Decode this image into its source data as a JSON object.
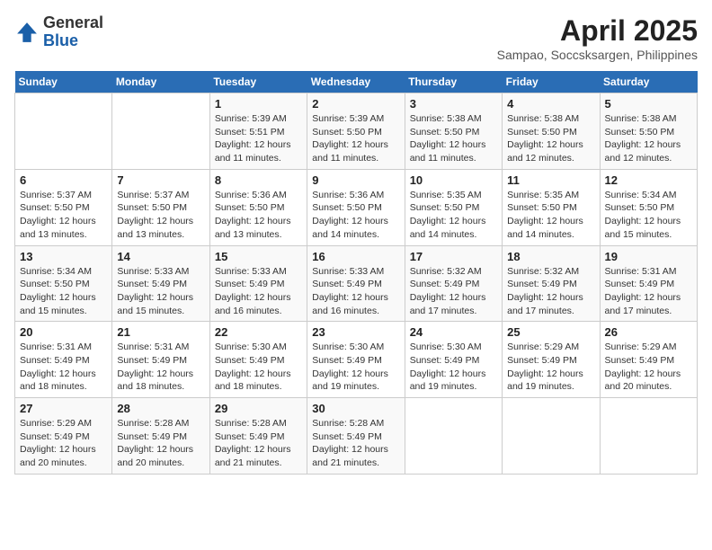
{
  "header": {
    "logo_line1": "General",
    "logo_line2": "Blue",
    "month_title": "April 2025",
    "location": "Sampao, Soccsksargen, Philippines"
  },
  "days_of_week": [
    "Sunday",
    "Monday",
    "Tuesday",
    "Wednesday",
    "Thursday",
    "Friday",
    "Saturday"
  ],
  "weeks": [
    [
      {
        "day": "",
        "sunrise": "",
        "sunset": "",
        "daylight": ""
      },
      {
        "day": "",
        "sunrise": "",
        "sunset": "",
        "daylight": ""
      },
      {
        "day": "1",
        "sunrise": "Sunrise: 5:39 AM",
        "sunset": "Sunset: 5:51 PM",
        "daylight": "Daylight: 12 hours and 11 minutes."
      },
      {
        "day": "2",
        "sunrise": "Sunrise: 5:39 AM",
        "sunset": "Sunset: 5:50 PM",
        "daylight": "Daylight: 12 hours and 11 minutes."
      },
      {
        "day": "3",
        "sunrise": "Sunrise: 5:38 AM",
        "sunset": "Sunset: 5:50 PM",
        "daylight": "Daylight: 12 hours and 11 minutes."
      },
      {
        "day": "4",
        "sunrise": "Sunrise: 5:38 AM",
        "sunset": "Sunset: 5:50 PM",
        "daylight": "Daylight: 12 hours and 12 minutes."
      },
      {
        "day": "5",
        "sunrise": "Sunrise: 5:38 AM",
        "sunset": "Sunset: 5:50 PM",
        "daylight": "Daylight: 12 hours and 12 minutes."
      }
    ],
    [
      {
        "day": "6",
        "sunrise": "Sunrise: 5:37 AM",
        "sunset": "Sunset: 5:50 PM",
        "daylight": "Daylight: 12 hours and 13 minutes."
      },
      {
        "day": "7",
        "sunrise": "Sunrise: 5:37 AM",
        "sunset": "Sunset: 5:50 PM",
        "daylight": "Daylight: 12 hours and 13 minutes."
      },
      {
        "day": "8",
        "sunrise": "Sunrise: 5:36 AM",
        "sunset": "Sunset: 5:50 PM",
        "daylight": "Daylight: 12 hours and 13 minutes."
      },
      {
        "day": "9",
        "sunrise": "Sunrise: 5:36 AM",
        "sunset": "Sunset: 5:50 PM",
        "daylight": "Daylight: 12 hours and 14 minutes."
      },
      {
        "day": "10",
        "sunrise": "Sunrise: 5:35 AM",
        "sunset": "Sunset: 5:50 PM",
        "daylight": "Daylight: 12 hours and 14 minutes."
      },
      {
        "day": "11",
        "sunrise": "Sunrise: 5:35 AM",
        "sunset": "Sunset: 5:50 PM",
        "daylight": "Daylight: 12 hours and 14 minutes."
      },
      {
        "day": "12",
        "sunrise": "Sunrise: 5:34 AM",
        "sunset": "Sunset: 5:50 PM",
        "daylight": "Daylight: 12 hours and 15 minutes."
      }
    ],
    [
      {
        "day": "13",
        "sunrise": "Sunrise: 5:34 AM",
        "sunset": "Sunset: 5:50 PM",
        "daylight": "Daylight: 12 hours and 15 minutes."
      },
      {
        "day": "14",
        "sunrise": "Sunrise: 5:33 AM",
        "sunset": "Sunset: 5:49 PM",
        "daylight": "Daylight: 12 hours and 15 minutes."
      },
      {
        "day": "15",
        "sunrise": "Sunrise: 5:33 AM",
        "sunset": "Sunset: 5:49 PM",
        "daylight": "Daylight: 12 hours and 16 minutes."
      },
      {
        "day": "16",
        "sunrise": "Sunrise: 5:33 AM",
        "sunset": "Sunset: 5:49 PM",
        "daylight": "Daylight: 12 hours and 16 minutes."
      },
      {
        "day": "17",
        "sunrise": "Sunrise: 5:32 AM",
        "sunset": "Sunset: 5:49 PM",
        "daylight": "Daylight: 12 hours and 17 minutes."
      },
      {
        "day": "18",
        "sunrise": "Sunrise: 5:32 AM",
        "sunset": "Sunset: 5:49 PM",
        "daylight": "Daylight: 12 hours and 17 minutes."
      },
      {
        "day": "19",
        "sunrise": "Sunrise: 5:31 AM",
        "sunset": "Sunset: 5:49 PM",
        "daylight": "Daylight: 12 hours and 17 minutes."
      }
    ],
    [
      {
        "day": "20",
        "sunrise": "Sunrise: 5:31 AM",
        "sunset": "Sunset: 5:49 PM",
        "daylight": "Daylight: 12 hours and 18 minutes."
      },
      {
        "day": "21",
        "sunrise": "Sunrise: 5:31 AM",
        "sunset": "Sunset: 5:49 PM",
        "daylight": "Daylight: 12 hours and 18 minutes."
      },
      {
        "day": "22",
        "sunrise": "Sunrise: 5:30 AM",
        "sunset": "Sunset: 5:49 PM",
        "daylight": "Daylight: 12 hours and 18 minutes."
      },
      {
        "day": "23",
        "sunrise": "Sunrise: 5:30 AM",
        "sunset": "Sunset: 5:49 PM",
        "daylight": "Daylight: 12 hours and 19 minutes."
      },
      {
        "day": "24",
        "sunrise": "Sunrise: 5:30 AM",
        "sunset": "Sunset: 5:49 PM",
        "daylight": "Daylight: 12 hours and 19 minutes."
      },
      {
        "day": "25",
        "sunrise": "Sunrise: 5:29 AM",
        "sunset": "Sunset: 5:49 PM",
        "daylight": "Daylight: 12 hours and 19 minutes."
      },
      {
        "day": "26",
        "sunrise": "Sunrise: 5:29 AM",
        "sunset": "Sunset: 5:49 PM",
        "daylight": "Daylight: 12 hours and 20 minutes."
      }
    ],
    [
      {
        "day": "27",
        "sunrise": "Sunrise: 5:29 AM",
        "sunset": "Sunset: 5:49 PM",
        "daylight": "Daylight: 12 hours and 20 minutes."
      },
      {
        "day": "28",
        "sunrise": "Sunrise: 5:28 AM",
        "sunset": "Sunset: 5:49 PM",
        "daylight": "Daylight: 12 hours and 20 minutes."
      },
      {
        "day": "29",
        "sunrise": "Sunrise: 5:28 AM",
        "sunset": "Sunset: 5:49 PM",
        "daylight": "Daylight: 12 hours and 21 minutes."
      },
      {
        "day": "30",
        "sunrise": "Sunrise: 5:28 AM",
        "sunset": "Sunset: 5:49 PM",
        "daylight": "Daylight: 12 hours and 21 minutes."
      },
      {
        "day": "",
        "sunrise": "",
        "sunset": "",
        "daylight": ""
      },
      {
        "day": "",
        "sunrise": "",
        "sunset": "",
        "daylight": ""
      },
      {
        "day": "",
        "sunrise": "",
        "sunset": "",
        "daylight": ""
      }
    ]
  ]
}
